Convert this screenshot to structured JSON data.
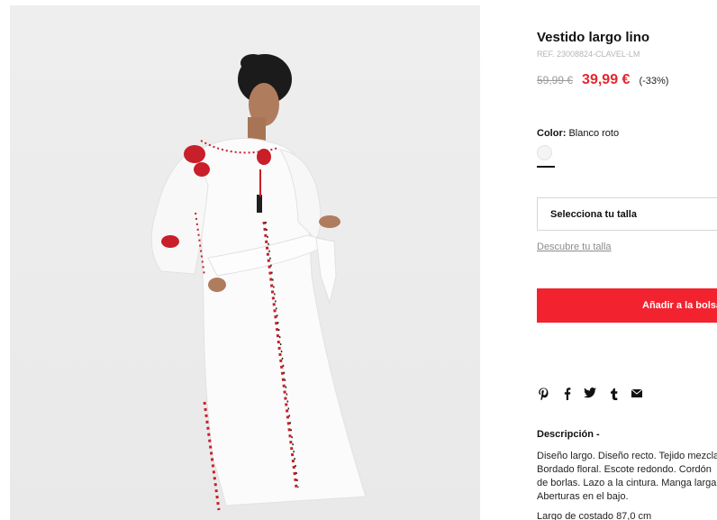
{
  "product": {
    "title": "Vestido largo lino",
    "ref": "REF. 23008824-CLAVEL-LM",
    "old_price": "59,99 €",
    "new_price": "39,99 €",
    "discount": "(-33%)"
  },
  "color": {
    "label": "Color:",
    "value": "Blanco roto",
    "swatch_hex": "#f4f4f2"
  },
  "size": {
    "select_label": "Selecciona tu talla",
    "guide_link": "Descubre tu talla"
  },
  "actions": {
    "add_to_bag": "Añadir a la bolsa"
  },
  "share": {
    "icons": [
      "pinterest-icon",
      "facebook-icon",
      "twitter-icon",
      "tumblr-icon",
      "email-icon"
    ]
  },
  "description": {
    "title": "Descripción -",
    "lines": [
      "Diseño largo. Diseño recto. Tejido mezcla de lino.",
      "Bordado floral. Escote redondo. Cordón",
      "de borlas. Lazo a la cintura. Manga larga.",
      "Aberturas en el bajo."
    ],
    "measure": "Largo de costado 87,0 cm"
  },
  "colors": {
    "accent": "#f2232f",
    "sale_price": "#e4252f"
  }
}
